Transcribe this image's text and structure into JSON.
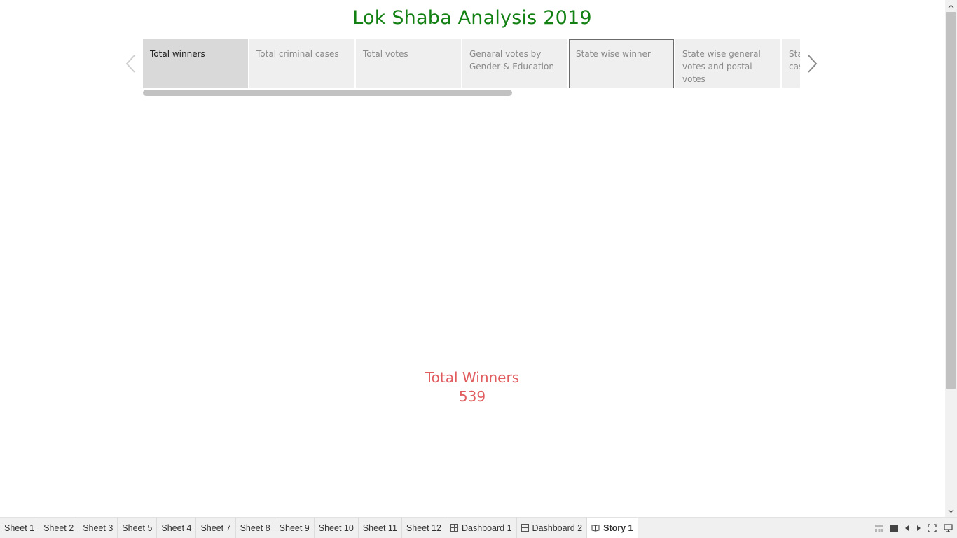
{
  "story": {
    "title": "Lok Shaba Analysis 2019",
    "points": [
      {
        "label": "Total winners"
      },
      {
        "label": "Total criminal cases"
      },
      {
        "label": "Total votes"
      },
      {
        "label": "Genaral votes by Gender & Education"
      },
      {
        "label": "State wise winner"
      },
      {
        "label": "State wise general votes and postal votes"
      },
      {
        "label": "State wise criminal cases"
      }
    ],
    "active_point": "Total winners"
  },
  "kpi": {
    "label": "Total Winners",
    "value": "539"
  },
  "tabs": [
    {
      "label": "Sheet 1",
      "icon": "none"
    },
    {
      "label": "Sheet 2",
      "icon": "none"
    },
    {
      "label": "Sheet 3",
      "icon": "none"
    },
    {
      "label": "Sheet 5",
      "icon": "none"
    },
    {
      "label": "Sheet 4",
      "icon": "none"
    },
    {
      "label": "Sheet 7",
      "icon": "none"
    },
    {
      "label": "Sheet 8",
      "icon": "none"
    },
    {
      "label": "Sheet 9",
      "icon": "none"
    },
    {
      "label": "Sheet 10",
      "icon": "none"
    },
    {
      "label": "Sheet 11",
      "icon": "none"
    },
    {
      "label": "Sheet 12",
      "icon": "none"
    },
    {
      "label": "Dashboard 1",
      "icon": "dashboard-icon"
    },
    {
      "label": "Dashboard 2",
      "icon": "dashboard-icon"
    },
    {
      "label": "Story 1",
      "icon": "story-icon"
    }
  ],
  "active_tab": "Story 1",
  "colors": {
    "title": "#128012",
    "kpi": "#e05c5f",
    "active_point_bg": "#d9d9d9",
    "point_bg": "#efefef"
  }
}
